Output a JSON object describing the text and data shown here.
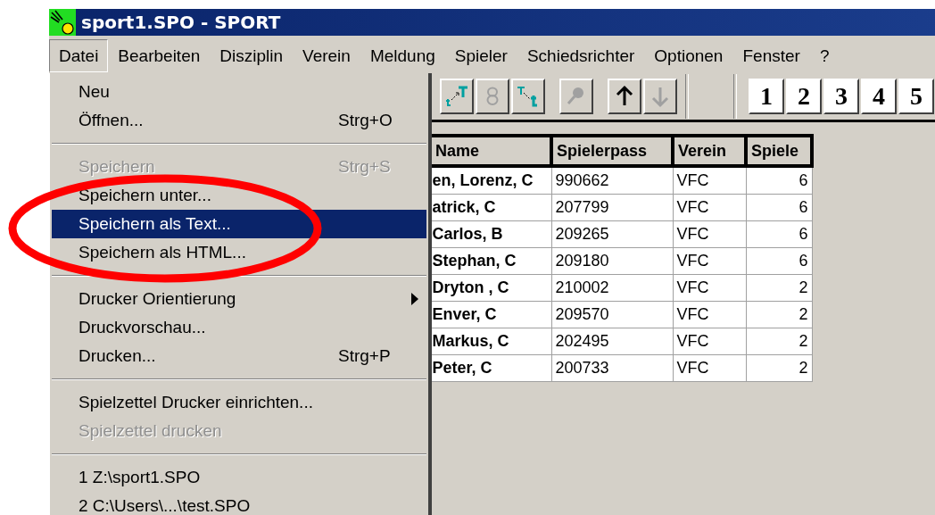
{
  "window": {
    "title": "sport1.SPO - SPORT"
  },
  "menu_bar": {
    "items": [
      {
        "label": "Datei",
        "selected": true
      },
      {
        "label": "Bearbeiten",
        "selected": false
      },
      {
        "label": "Disziplin",
        "selected": false
      },
      {
        "label": "Verein",
        "selected": false
      },
      {
        "label": "Meldung",
        "selected": false
      },
      {
        "label": "Spieler",
        "selected": false
      },
      {
        "label": "Schiedsrichter",
        "selected": false
      },
      {
        "label": "Optionen",
        "selected": false
      },
      {
        "label": "Fenster",
        "selected": false
      },
      {
        "label": "?",
        "selected": false
      }
    ]
  },
  "file_menu": {
    "items": [
      {
        "kind": "item",
        "label": "Neu",
        "disabled": false,
        "selected": false
      },
      {
        "kind": "item",
        "label": "Öffnen...",
        "shortcut": "Strg+O",
        "disabled": false,
        "selected": false
      },
      {
        "kind": "separator"
      },
      {
        "kind": "item",
        "label": "Speichern",
        "shortcut": "Strg+S",
        "disabled": true,
        "selected": false
      },
      {
        "kind": "item",
        "label": "Speichern unter...",
        "disabled": false,
        "selected": false
      },
      {
        "kind": "item",
        "label": "Speichern als Text...",
        "disabled": false,
        "selected": true
      },
      {
        "kind": "item",
        "label": "Speichern als HTML...",
        "disabled": false,
        "selected": false
      },
      {
        "kind": "separator"
      },
      {
        "kind": "submenu",
        "label": "Drucker Orientierung",
        "disabled": false,
        "selected": false
      },
      {
        "kind": "item",
        "label": "Druckvorschau...",
        "disabled": false,
        "selected": false
      },
      {
        "kind": "item",
        "label": "Drucken...",
        "shortcut": "Strg+P",
        "disabled": false,
        "selected": false
      },
      {
        "kind": "separator"
      },
      {
        "kind": "item",
        "label": "Spielzettel Drucker einrichten...",
        "disabled": false,
        "selected": false
      },
      {
        "kind": "item",
        "label": "Spielzettel drucken",
        "disabled": true,
        "selected": false
      },
      {
        "kind": "separator"
      },
      {
        "kind": "item",
        "label": "1 Z:\\sport1.SPO",
        "disabled": false,
        "selected": false
      },
      {
        "kind": "item",
        "label": "2 C:\\Users\\...\\test.SPO",
        "disabled": false,
        "selected": false
      }
    ]
  },
  "toolbar": {
    "buttons": [
      {
        "kind": "raise-case",
        "disabled": false
      },
      {
        "kind": "link",
        "disabled": true
      },
      {
        "kind": "lower-case",
        "disabled": false
      },
      {
        "kind": "search",
        "disabled": true
      },
      {
        "kind": "up",
        "disabled": false
      },
      {
        "kind": "down",
        "disabled": true
      }
    ],
    "number_buttons": [
      "1",
      "2",
      "3",
      "4",
      "5"
    ]
  },
  "table": {
    "columns": [
      "Name",
      "Spielerpass",
      "Verein",
      "Spiele"
    ],
    "rows": [
      [
        "en, Lorenz, C",
        "990662",
        "VFC",
        "6"
      ],
      [
        "atrick, C",
        "207799",
        "VFC",
        "6"
      ],
      [
        "Carlos, B",
        "209265",
        "VFC",
        "6"
      ],
      [
        "Stephan, C",
        "209180",
        "VFC",
        "6"
      ],
      [
        "Dryton , C",
        "210002",
        "VFC",
        "2"
      ],
      [
        "Enver, C",
        "209570",
        "VFC",
        "2"
      ],
      [
        "Markus, C",
        "202495",
        "VFC",
        "2"
      ],
      [
        "Peter, C",
        "200733",
        "VFC",
        "2"
      ]
    ]
  }
}
